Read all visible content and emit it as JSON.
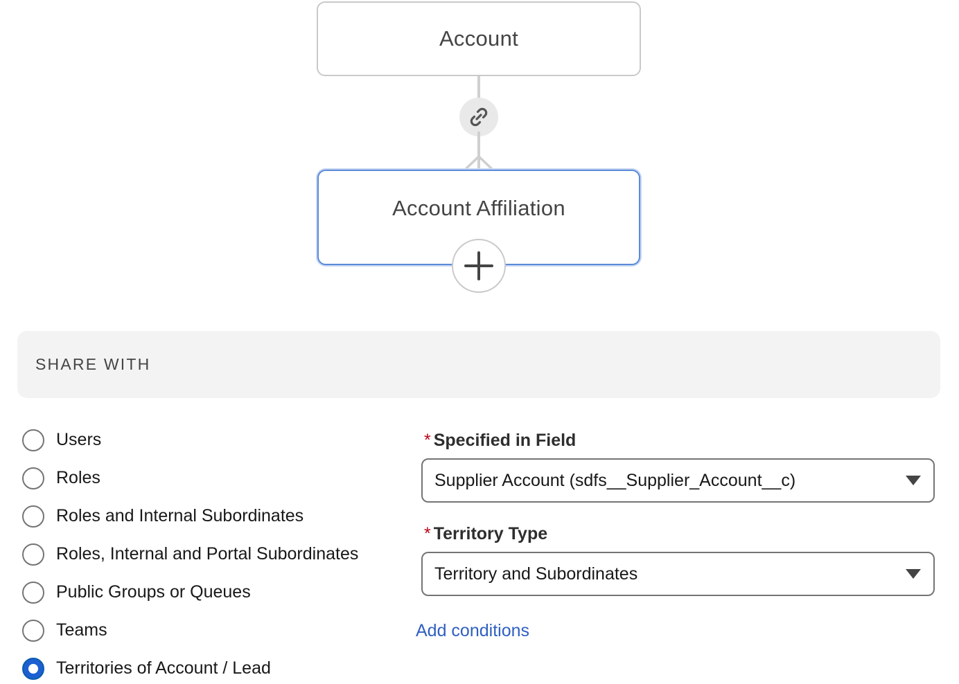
{
  "graph": {
    "parent_object": "Account",
    "child_object": "Account Affiliation"
  },
  "share_with": {
    "title": "SHARE WITH",
    "options": [
      {
        "label": "Users",
        "checked": false
      },
      {
        "label": "Roles",
        "checked": false
      },
      {
        "label": "Roles and Internal Subordinates",
        "checked": false
      },
      {
        "label": "Roles, Internal and Portal Subordinates",
        "checked": false
      },
      {
        "label": "Public Groups or Queues",
        "checked": false
      },
      {
        "label": "Teams",
        "checked": false
      },
      {
        "label": "Territories of Account / Lead",
        "checked": true
      }
    ]
  },
  "fields": {
    "specified_in_field": {
      "required_marker": "*",
      "label": "Specified in Field",
      "value": "Supplier Account (sdfs__Supplier_Account__c)"
    },
    "territory_type": {
      "required_marker": "*",
      "label": "Territory Type",
      "value": "Territory and Subordinates"
    }
  },
  "actions": {
    "add_conditions": "Add conditions"
  },
  "icons": {
    "link": "link-icon",
    "add": "plus-icon",
    "dropdown": "chevron-down-icon"
  },
  "colors": {
    "accent": "#1b5fd2",
    "link": "#2f5fc2",
    "required": "#ba0517",
    "selected_node_border": "#5b8ad8"
  }
}
